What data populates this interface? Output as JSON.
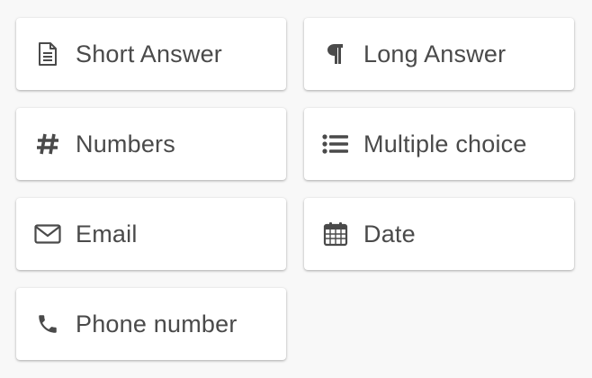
{
  "field_types": [
    {
      "label": "Short Answer",
      "icon": "document-icon"
    },
    {
      "label": "Long Answer",
      "icon": "paragraph-icon"
    },
    {
      "label": "Numbers",
      "icon": "hash-icon"
    },
    {
      "label": "Multiple choice",
      "icon": "list-icon"
    },
    {
      "label": "Email",
      "icon": "envelope-icon"
    },
    {
      "label": "Date",
      "icon": "calendar-icon"
    },
    {
      "label": "Phone number",
      "icon": "phone-icon"
    }
  ],
  "colors": {
    "background": "#f8f8f8",
    "card": "#ffffff",
    "text": "#4a4a4a",
    "icon": "#4a4a4a"
  }
}
